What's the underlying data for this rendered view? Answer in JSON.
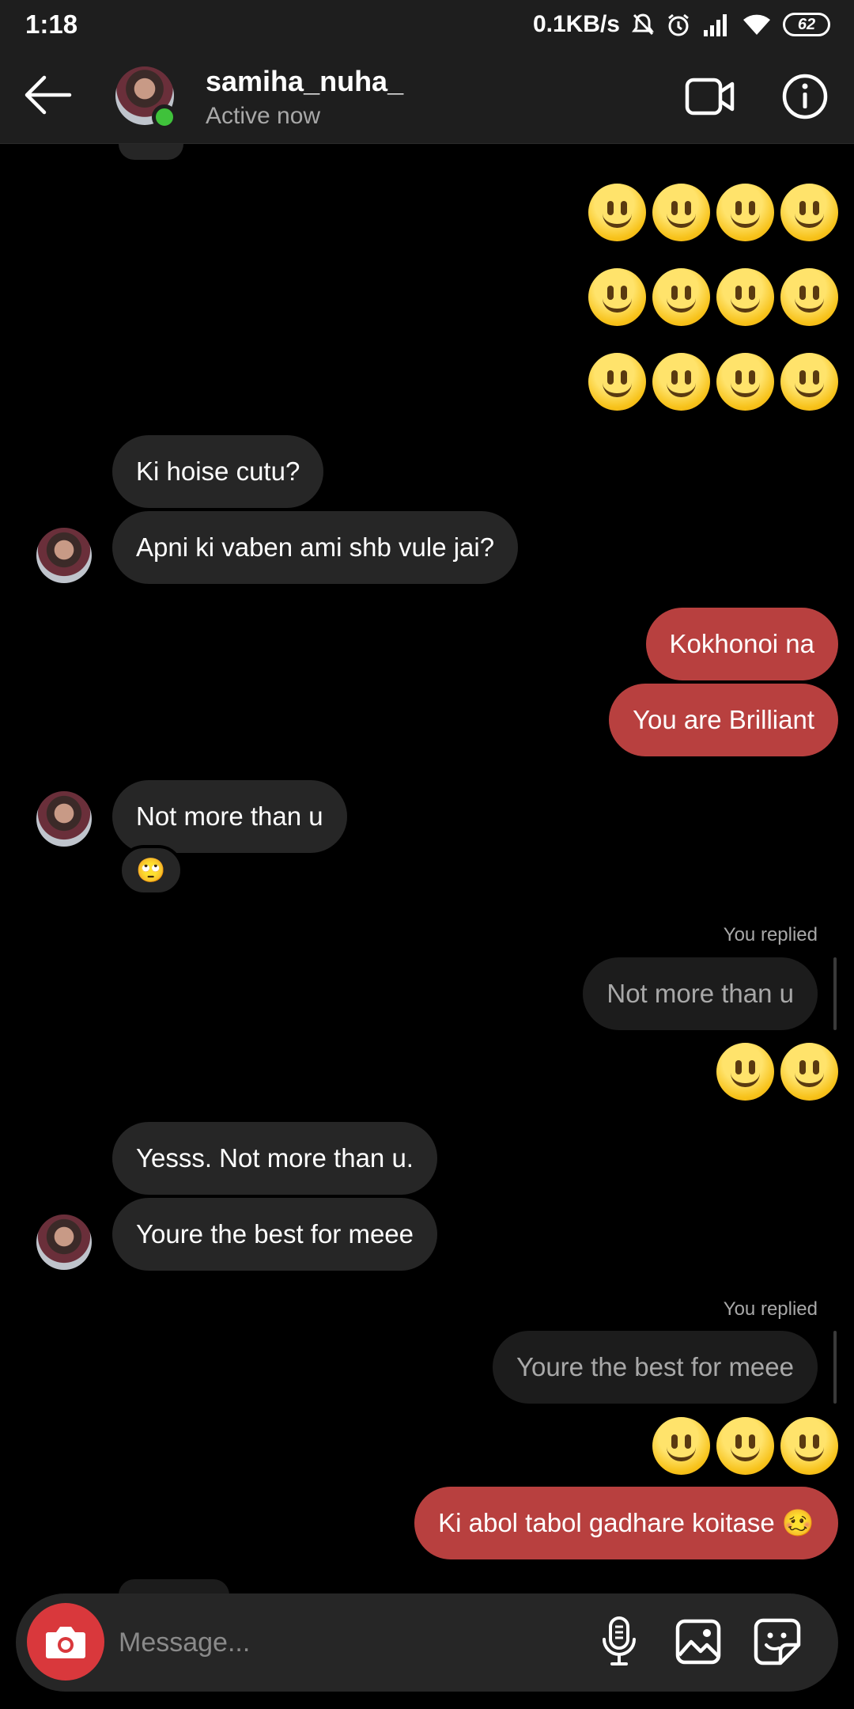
{
  "status_bar": {
    "time": "1:18",
    "net_speed": "0.1KB/s",
    "battery": "62"
  },
  "header": {
    "username": "samiha_nuha_",
    "status": "Active now",
    "active_color": "#3fc23b"
  },
  "messages": {
    "emoji_rows": [
      {
        "glyph": "🙂",
        "count": 4
      },
      {
        "glyph": "🙂",
        "count": 4
      },
      {
        "glyph": "🙂",
        "count": 4
      }
    ],
    "m1": "Ki hoise cutu?",
    "m2": "Apni ki vaben ami shb vule jai?",
    "m3": "Kokhonoi na",
    "m4": "You are Brilliant",
    "m5": "Not more than u",
    "m5_reaction": "🙄",
    "reply1": {
      "label": "You replied",
      "quoted": "Not more than u",
      "emoji_count": 2
    },
    "m6": "Yesss. Not more than u.",
    "m7": "Youre the best for meee",
    "reply2": {
      "label": "You replied",
      "quoted": "Youre the best for meee",
      "emoji_count": 3
    },
    "m8": "Ki abol tabol gadhare koitase 🥴"
  },
  "composer": {
    "placeholder": "Message..."
  },
  "colors": {
    "outgoing": "#b8403f",
    "incoming": "#262626",
    "camera": "#d9383c"
  }
}
